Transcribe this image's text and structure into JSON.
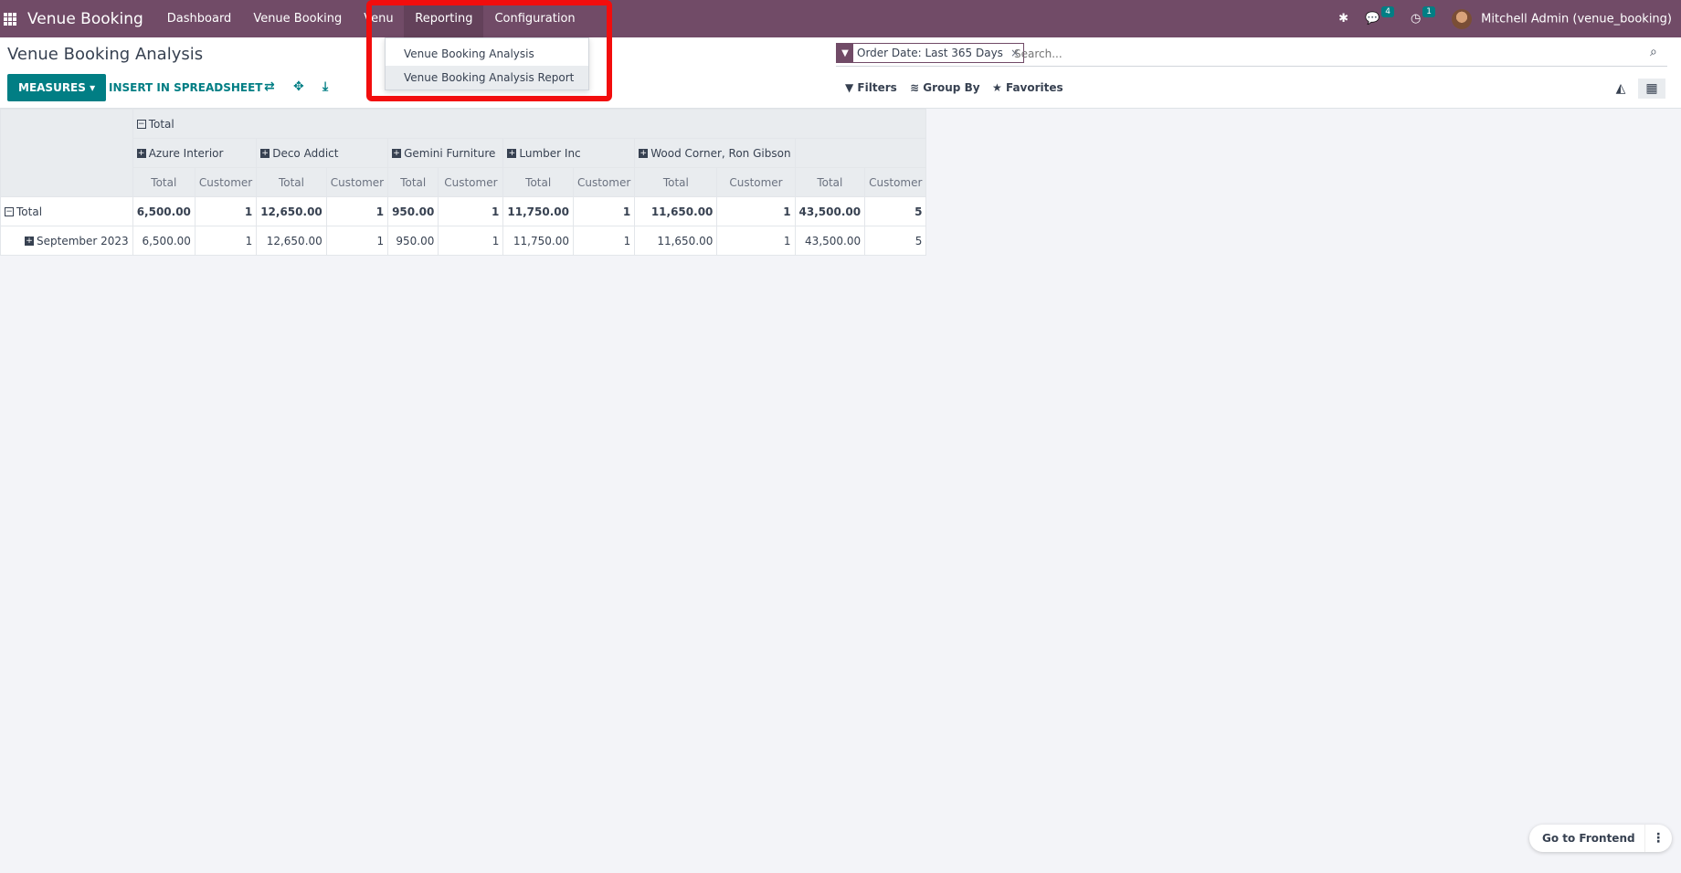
{
  "navbar": {
    "brand": "Venue Booking",
    "menu": [
      "Dashboard",
      "Venue Booking",
      "Venu",
      "Reporting",
      "Configuration"
    ],
    "messages_count": "4",
    "activities_count": "1",
    "user": "Mitchell Admin (venue_booking)"
  },
  "reporting_menu": {
    "items": [
      "Venue Booking Analysis",
      "Venue Booking Analysis Report"
    ]
  },
  "control": {
    "title": "Venue Booking Analysis",
    "measures_label": "MEASURES",
    "insert_label": "INSERT IN SPREADSHEET",
    "facet_label": "Order Date: Last 365 Days",
    "facet_close": "×",
    "search_placeholder": "Search...",
    "filters_label": "Filters",
    "groupby_label": "Group By",
    "favorites_label": "Favorites"
  },
  "pivot": {
    "col_total_label": "Total",
    "columns": [
      "Azure Interior",
      "Deco Addict",
      "Gemini Furniture",
      "Lumber Inc",
      "Wood Corner, Ron Gibson"
    ],
    "measures": [
      "Total",
      "Customer"
    ],
    "rows": [
      {
        "label": "Total",
        "values": [
          "6,500.00",
          "1",
          "12,650.00",
          "1",
          "950.00",
          "1",
          "11,750.00",
          "1",
          "11,650.00",
          "1",
          "43,500.00",
          "5"
        ]
      },
      {
        "label": "September 2023",
        "values": [
          "6,500.00",
          "1",
          "12,650.00",
          "1",
          "950.00",
          "1",
          "11,750.00",
          "1",
          "11,650.00",
          "1",
          "43,500.00",
          "5"
        ]
      }
    ]
  },
  "footer": {
    "goto_label": "Go to Frontend"
  }
}
